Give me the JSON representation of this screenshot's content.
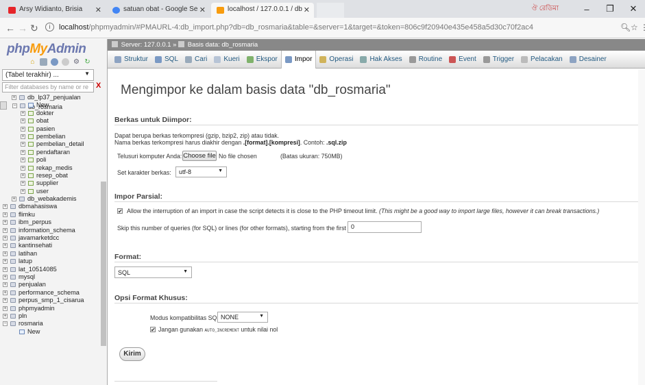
{
  "browser": {
    "tabs": [
      {
        "label": "Arsy Widianto, Brisia",
        "favicon_color": "#e6252a"
      },
      {
        "label": "satuan obat - Google Se",
        "favicon_color": "#4285f4"
      },
      {
        "label": "localhost / 127.0.0.1 / db",
        "favicon_color": "#f89c0e"
      }
    ],
    "profile_label": "ঔ রেডিমা",
    "url_host": "localhost",
    "url_path": "/phpmyadmin/#PMAURL-4:db_import.php?db=db_rosmaria&table=&server=1&target=&token=806c9f20940e435e458a5d30c70f2ac4"
  },
  "pma": {
    "logo": {
      "php": "php",
      "my": "My",
      "admin": "Admin"
    },
    "recent_label": "(Tabel terakhir) ...",
    "filter_placeholder": "Filter databases by name or re",
    "tree": [
      {
        "label": "db_lp37_penjualan",
        "level": 1,
        "kind": "db",
        "exp": "+"
      },
      {
        "label": "db_rosmaria",
        "level": 1,
        "kind": "db",
        "exp": "−",
        "selected": true
      },
      {
        "label": "New",
        "level": 2,
        "kind": "new",
        "exp": ""
      },
      {
        "label": "dokter",
        "level": 2,
        "kind": "tbl",
        "exp": "+"
      },
      {
        "label": "obat",
        "level": 2,
        "kind": "tbl",
        "exp": "+"
      },
      {
        "label": "pasien",
        "level": 2,
        "kind": "tbl",
        "exp": "+"
      },
      {
        "label": "pembelian",
        "level": 2,
        "kind": "tbl",
        "exp": "+"
      },
      {
        "label": "pembelian_detail",
        "level": 2,
        "kind": "tbl",
        "exp": "+"
      },
      {
        "label": "pendaftaran",
        "level": 2,
        "kind": "tbl",
        "exp": "+"
      },
      {
        "label": "poli",
        "level": 2,
        "kind": "tbl",
        "exp": "+"
      },
      {
        "label": "rekap_medis",
        "level": 2,
        "kind": "tbl",
        "exp": "+"
      },
      {
        "label": "resep_obat",
        "level": 2,
        "kind": "tbl",
        "exp": "+"
      },
      {
        "label": "supplier",
        "level": 2,
        "kind": "tbl",
        "exp": "+"
      },
      {
        "label": "user",
        "level": 2,
        "kind": "tbl",
        "exp": "+"
      },
      {
        "label": "db_webakademis",
        "level": 1,
        "kind": "db",
        "exp": "+"
      },
      {
        "label": "dbmahasiswa",
        "level": 0,
        "kind": "db",
        "exp": "+"
      },
      {
        "label": "flimku",
        "level": 0,
        "kind": "db",
        "exp": "+"
      },
      {
        "label": "ibm_perpus",
        "level": 0,
        "kind": "db",
        "exp": "+"
      },
      {
        "label": "information_schema",
        "level": 0,
        "kind": "db",
        "exp": "+"
      },
      {
        "label": "javamarketdcc",
        "level": 0,
        "kind": "db",
        "exp": "+"
      },
      {
        "label": "kantinsehati",
        "level": 0,
        "kind": "db",
        "exp": "+"
      },
      {
        "label": "latihan",
        "level": 0,
        "kind": "db",
        "exp": "+"
      },
      {
        "label": "latup",
        "level": 0,
        "kind": "db",
        "exp": "+"
      },
      {
        "label": "lat_10514085",
        "level": 0,
        "kind": "db",
        "exp": "+"
      },
      {
        "label": "mysql",
        "level": 0,
        "kind": "db",
        "exp": "+"
      },
      {
        "label": "penjualan",
        "level": 0,
        "kind": "db",
        "exp": "+"
      },
      {
        "label": "performance_schema",
        "level": 0,
        "kind": "db",
        "exp": "+"
      },
      {
        "label": "perpus_smp_1_cisarua",
        "level": 0,
        "kind": "db",
        "exp": "+"
      },
      {
        "label": "phpmyadmin",
        "level": 0,
        "kind": "db",
        "exp": "+"
      },
      {
        "label": "pln",
        "level": 0,
        "kind": "db",
        "exp": "+"
      },
      {
        "label": "rosmaria",
        "level": 0,
        "kind": "db",
        "exp": "−"
      },
      {
        "label": "New",
        "level": 1,
        "kind": "new",
        "exp": ""
      }
    ],
    "breadcrumb": {
      "server": "Server: 127.0.0.1",
      "sep": "»",
      "db": "Basis data: db_rosmaria"
    },
    "menu": [
      {
        "label": "Struktur",
        "color": "#8da3c2"
      },
      {
        "label": "SQL",
        "color": "#7a99c4"
      },
      {
        "label": "Cari",
        "color": "#9ab"
      },
      {
        "label": "Kueri",
        "color": "#b7c4d6"
      },
      {
        "label": "Ekspor",
        "color": "#7fb26b"
      },
      {
        "label": "Impor",
        "color": "#7a99c4",
        "active": true
      },
      {
        "label": "Operasi",
        "color": "#d0b35a"
      },
      {
        "label": "Hak Akses",
        "color": "#8aa"
      },
      {
        "label": "Routine",
        "color": "#999"
      },
      {
        "label": "Event",
        "color": "#c55"
      },
      {
        "label": "Trigger",
        "color": "#999"
      },
      {
        "label": "Pelacakan",
        "color": "#bbb"
      },
      {
        "label": "Desainer",
        "color": "#8da3c2"
      }
    ],
    "page_title": "Mengimpor ke dalam basis data \"db_rosmaria\"",
    "file_section": {
      "legend": "Berkas untuk Diimpor:",
      "line1": "Dapat berupa berkas terkompresi (gzip, bzip2, zip) atau tidak.",
      "line2_pre": "Nama berkas terkompresi harus diakhir dengan ",
      "line2_bold": ".[format].[kompresi]",
      "line2_mid": ". Contoh: ",
      "line2_bold2": ".sql.zip",
      "browse_label": "Telusuri komputer Anda:",
      "choose_button": "Choose file",
      "no_file": "No file chosen",
      "max_size": "(Batas ukuran: 750MB)",
      "charset_label": "Set karakter berkas:",
      "charset_value": "utf-8"
    },
    "partial_section": {
      "legend": "Impor Parsial:",
      "allow_text": "Allow the interruption of an import in case the script detects it is close to the PHP timeout limit.",
      "allow_hint": "(This might be a good way to import large files, however it can break transactions.)",
      "allow_checked": true,
      "skip_label": "Skip this number of queries (for SQL) or lines (for other formats), starting from the first one:",
      "skip_value": "0"
    },
    "format_section": {
      "legend": "Format:",
      "value": "SQL"
    },
    "options_section": {
      "legend": "Opsi Format Khusus:",
      "compat_label": "Modus kompatibilitas SQL:",
      "compat_value": "NONE",
      "noauto_pre": "Jangan gunakan",
      "noauto_code": "AUTO_INCREMENT",
      "noauto_post": "untuk nilai nol",
      "noauto_checked": true
    },
    "submit_label": "Kirim"
  }
}
